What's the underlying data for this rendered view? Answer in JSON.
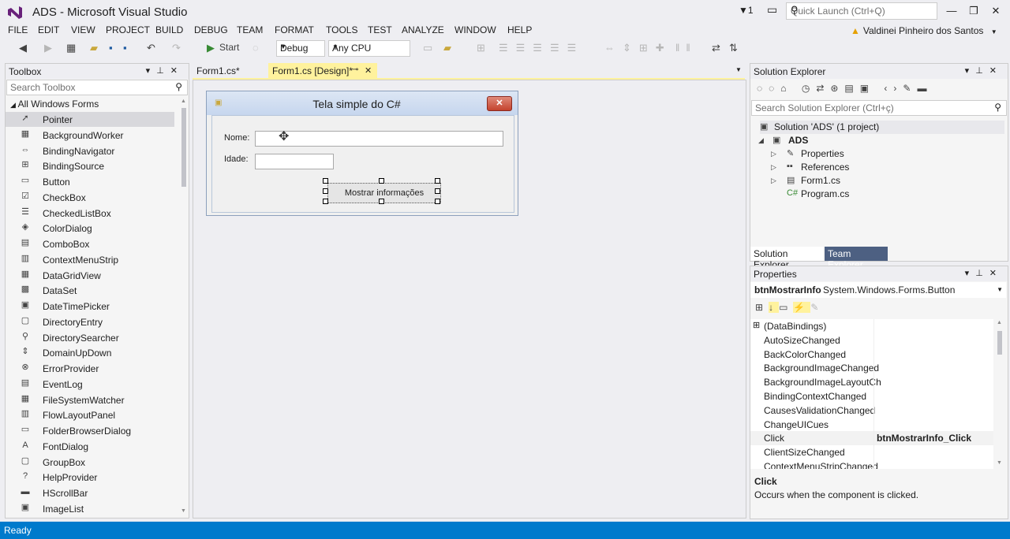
{
  "title": {
    "app_title": "ADS - Microsoft Visual Studio",
    "notifications": "1"
  },
  "quick_launch": {
    "placeholder": "Quick Launch (Ctrl+Q)"
  },
  "menu": [
    "FILE",
    "EDIT",
    "VIEW",
    "PROJECT",
    "BUILD",
    "DEBUG",
    "TEAM",
    "FORMAT",
    "TOOLS",
    "TEST",
    "ANALYZE",
    "WINDOW",
    "HELP"
  ],
  "user": {
    "name": "Valdinei Pinheiro dos Santos"
  },
  "toolbar": {
    "start_label": "Start",
    "config": "Debug",
    "platform": "Any CPU"
  },
  "toolbox": {
    "title": "Toolbox",
    "search_placeholder": "Search Toolbox",
    "group": "All Windows Forms",
    "items": [
      {
        "label": "Pointer",
        "icon": "pointer-icon",
        "glyph": "➚"
      },
      {
        "label": "BackgroundWorker",
        "icon": "backgroundworker-icon",
        "glyph": "▦"
      },
      {
        "label": "BindingNavigator",
        "icon": "bindingnavigator-icon",
        "glyph": "⇔"
      },
      {
        "label": "BindingSource",
        "icon": "bindingsource-icon",
        "glyph": "⊞"
      },
      {
        "label": "Button",
        "icon": "button-icon",
        "glyph": "▭"
      },
      {
        "label": "CheckBox",
        "icon": "checkbox-icon",
        "glyph": "☑"
      },
      {
        "label": "CheckedListBox",
        "icon": "checkedlistbox-icon",
        "glyph": "☰"
      },
      {
        "label": "ColorDialog",
        "icon": "colordialog-icon",
        "glyph": "◈"
      },
      {
        "label": "ComboBox",
        "icon": "combobox-icon",
        "glyph": "▤"
      },
      {
        "label": "ContextMenuStrip",
        "icon": "contextmenustrip-icon",
        "glyph": "▥"
      },
      {
        "label": "DataGridView",
        "icon": "datagridview-icon",
        "glyph": "▦"
      },
      {
        "label": "DataSet",
        "icon": "dataset-icon",
        "glyph": "▩"
      },
      {
        "label": "DateTimePicker",
        "icon": "datetimepicker-icon",
        "glyph": "▣"
      },
      {
        "label": "DirectoryEntry",
        "icon": "directoryentry-icon",
        "glyph": "▢"
      },
      {
        "label": "DirectorySearcher",
        "icon": "directorysearcher-icon",
        "glyph": "⚲"
      },
      {
        "label": "DomainUpDown",
        "icon": "domainupdown-icon",
        "glyph": "⇕"
      },
      {
        "label": "ErrorProvider",
        "icon": "errorprovider-icon",
        "glyph": "⊗"
      },
      {
        "label": "EventLog",
        "icon": "eventlog-icon",
        "glyph": "▤"
      },
      {
        "label": "FileSystemWatcher",
        "icon": "filesystemwatcher-icon",
        "glyph": "▦"
      },
      {
        "label": "FlowLayoutPanel",
        "icon": "flowlayoutpanel-icon",
        "glyph": "▥"
      },
      {
        "label": "FolderBrowserDialog",
        "icon": "folderbrowserdialog-icon",
        "glyph": "▭"
      },
      {
        "label": "FontDialog",
        "icon": "fontdialog-icon",
        "glyph": "A"
      },
      {
        "label": "GroupBox",
        "icon": "groupbox-icon",
        "glyph": "▢"
      },
      {
        "label": "HelpProvider",
        "icon": "helpprovider-icon",
        "glyph": "?"
      },
      {
        "label": "HScrollBar",
        "icon": "hscrollbar-icon",
        "glyph": "▬"
      },
      {
        "label": "ImageList",
        "icon": "imagelist-icon",
        "glyph": "▣"
      }
    ]
  },
  "doc_tabs": [
    {
      "label": "Form1.cs*",
      "active": false
    },
    {
      "label": "Form1.cs [Design]*",
      "active": true
    }
  ],
  "form": {
    "caption": "Tela simple do C#",
    "nome_label": "Nome:",
    "idade_label": "Idade:",
    "button_label": "Mostrar informações"
  },
  "solution_explorer": {
    "title": "Solution Explorer",
    "search_placeholder": "Search Solution Explorer (Ctrl+ç)",
    "solution": "Solution 'ADS' (1 project)",
    "project": "ADS",
    "nodes": [
      "Properties",
      "References",
      "Form1.cs",
      "Program.cs"
    ],
    "tabs": [
      "Solution Explorer",
      "Team Explorer"
    ]
  },
  "properties": {
    "title": "Properties",
    "object_name": "btnMostrarInfo",
    "object_type": "System.Windows.Forms.Button",
    "rows": [
      {
        "name": "(DataBindings)",
        "value": ""
      },
      {
        "name": "AutoSizeChanged",
        "value": ""
      },
      {
        "name": "BackColorChanged",
        "value": ""
      },
      {
        "name": "BackgroundImageChanged",
        "value": ""
      },
      {
        "name": "BackgroundImageLayoutCh",
        "value": ""
      },
      {
        "name": "BindingContextChanged",
        "value": ""
      },
      {
        "name": "CausesValidationChanged",
        "value": ""
      },
      {
        "name": "ChangeUICues",
        "value": ""
      },
      {
        "name": "Click",
        "value": "btnMostrarInfo_Click"
      },
      {
        "name": "ClientSizeChanged",
        "value": ""
      },
      {
        "name": "ContextMenuStripChanged",
        "value": ""
      }
    ],
    "desc_title": "Click",
    "desc_text": "Occurs when the component is clicked."
  },
  "status": {
    "text": "Ready"
  },
  "colors": {
    "accent": "#007acc",
    "tab_active": "#fff29d"
  }
}
